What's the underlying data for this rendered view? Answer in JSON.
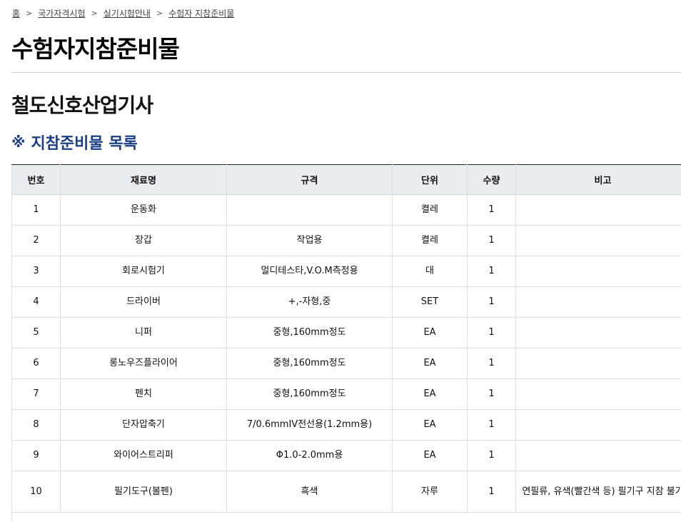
{
  "breadcrumb": {
    "items": [
      "홈",
      "국가자격시험",
      "실기시험안내",
      "수험자 지참준비물"
    ],
    "separator": ">"
  },
  "page_title": "수험자지참준비물",
  "exam_title": "철도신호산업기사",
  "section": {
    "mark": "※",
    "title": "지참준비물 목록"
  },
  "table": {
    "headers": [
      "번호",
      "재료명",
      "규격",
      "단위",
      "수량",
      "비고"
    ],
    "rows": [
      [
        "1",
        "운동화",
        "",
        "켤레",
        "1",
        ""
      ],
      [
        "2",
        "장갑",
        "작업용",
        "켤레",
        "1",
        ""
      ],
      [
        "3",
        "회로시험기",
        "멀디테스타,V.O.M측정용",
        "대",
        "1",
        ""
      ],
      [
        "4",
        "드라이버",
        "+,-자형,중",
        "SET",
        "1",
        ""
      ],
      [
        "5",
        "니퍼",
        "중형,160mm정도",
        "EA",
        "1",
        ""
      ],
      [
        "6",
        "롱노우즈플라이어",
        "중형,160mm정도",
        "EA",
        "1",
        ""
      ],
      [
        "7",
        "펜치",
        "중형,160mm정도",
        "EA",
        "1",
        ""
      ],
      [
        "8",
        "단자압축기",
        "7/0.6mmIV전선용(1.2mm용)",
        "EA",
        "1",
        ""
      ],
      [
        "9",
        "와이어스트리퍼",
        "Φ1.0-2.0mm용",
        "EA",
        "1",
        ""
      ],
      [
        "10",
        "필기도구(볼펜)",
        "흑색",
        "자루",
        "1",
        "연필류, 유색(빨간색 등) 필기구 지참 불가"
      ]
    ]
  },
  "colors": {
    "section_title": "#1a3f86",
    "table_header_bg": "#e9ecf1"
  }
}
